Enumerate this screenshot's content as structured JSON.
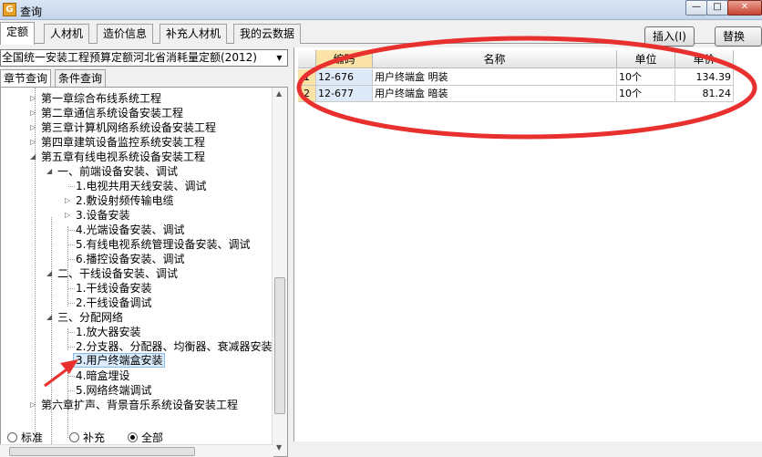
{
  "window": {
    "title": "查询",
    "app_icon_glyph": "G",
    "minimize_glyph": "—",
    "maximize_glyph": "□",
    "close_glyph": "✕"
  },
  "main_tabs": [
    {
      "label": "定额",
      "active": true
    },
    {
      "label": "人材机"
    },
    {
      "label": "造价信息"
    },
    {
      "label": "补充人材机"
    },
    {
      "label": "我的云数据"
    }
  ],
  "actions": {
    "insert": "插入(I)",
    "replace": "替换(R)"
  },
  "quota_select": {
    "value": "全国统一安装工程预算定额河北省消耗量定额(2012)",
    "arrow": "▼"
  },
  "sub_tabs": [
    {
      "label": "章节查询",
      "active": true
    },
    {
      "label": "条件查询"
    }
  ],
  "tree": [
    {
      "label": "第一章综合布线系统工程",
      "toggle": "▷"
    },
    {
      "label": "第二章通信系统设备安装工程",
      "toggle": "▷"
    },
    {
      "label": "第三章计算机网络系统设备安装工程",
      "toggle": "▷"
    },
    {
      "label": "第四章建筑设备监控系统安装工程",
      "toggle": "▷"
    },
    {
      "label": "第五章有线电视系统设备安装工程",
      "toggle": "◢"
    },
    {
      "label": "一、前端设备安装、调试",
      "toggle": "◢"
    },
    {
      "label": "1.电视共用天线安装、调试",
      "toggle": ""
    },
    {
      "label": "2.敷设射频传输电缆",
      "toggle": "▷"
    },
    {
      "label": "3.设备安装",
      "toggle": "▷"
    },
    {
      "label": "4.光端设备安装、调试",
      "toggle": ""
    },
    {
      "label": "5.有线电视系统管理设备安装、调试",
      "toggle": ""
    },
    {
      "label": "6.播控设备安装、调试",
      "toggle": ""
    },
    {
      "label": "二、干线设备安装、调试",
      "toggle": "◢"
    },
    {
      "label": "1.干线设备安装",
      "toggle": ""
    },
    {
      "label": "2.干线设备调试",
      "toggle": ""
    },
    {
      "label": "三、分配网络",
      "toggle": "◢"
    },
    {
      "label": "1.放大器安装",
      "toggle": ""
    },
    {
      "label": "2.分支器、分配器、均衡器、衰减器安装",
      "toggle": ""
    },
    {
      "label": "3.用户终端盒安装",
      "toggle": "",
      "selected": true
    },
    {
      "label": "4.暗盒埋设",
      "toggle": ""
    },
    {
      "label": "5.网络终端调试",
      "toggle": ""
    },
    {
      "label": "第六章扩声、背景音乐系统设备安装工程",
      "toggle": "▷"
    }
  ],
  "scroll_glyphs": {
    "up": "▲",
    "down": "▼"
  },
  "filter_radios": [
    {
      "label": "标准",
      "checked": false
    },
    {
      "label": "补充",
      "checked": false
    },
    {
      "label": "全部",
      "checked": true
    }
  ],
  "grid": {
    "columns": [
      "",
      "编码",
      "名称",
      "单位",
      "单价"
    ],
    "rows": [
      {
        "num": "1",
        "code": "12-676",
        "name": "用户终端盒 明装",
        "unit": "10个",
        "price": "134.39"
      },
      {
        "num": "2",
        "code": "12-677",
        "name": "用户终端盒 暗装",
        "unit": "10个",
        "price": "81.24"
      }
    ]
  },
  "colors": {
    "annotation": "#e8312f",
    "selection": "#d9ebfc",
    "header_active": "#fbe3a7"
  }
}
